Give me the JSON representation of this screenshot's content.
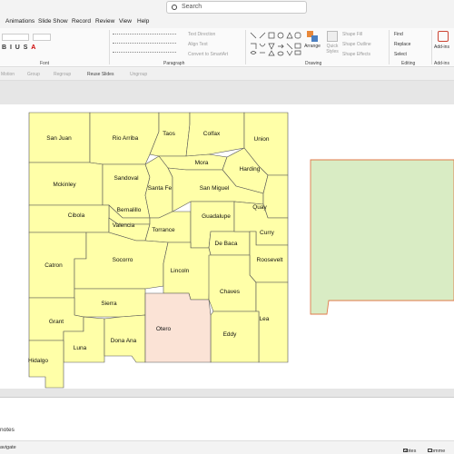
{
  "search": {
    "placeholder": "Search"
  },
  "tabs": [
    "Animations",
    "Slide Show",
    "Record",
    "Review",
    "View",
    "Help"
  ],
  "ribbon": {
    "groups": {
      "font": "Font",
      "paragraph": "Paragraph",
      "drawing": "Drawing",
      "editing": "Editing",
      "addins": "Add-ins"
    },
    "text_direction": "Text Direction",
    "align_text": "Align Text",
    "convert_smartart": "Convert to SmartArt",
    "arrange": "Arrange",
    "quick_styles": "Quick Styles",
    "shape_fill": "Shape Fill",
    "shape_outline": "Shape Outline",
    "shape_effects": "Shape Effects",
    "find": "Find",
    "replace": "Replace",
    "select": "Select",
    "addins_btn": "Add-ins"
  },
  "qat": {
    "motion": "Motion",
    "group": "Group",
    "regroup": "Regroup",
    "reuse": "Reuse Slides",
    "ungroup": "Ungroup"
  },
  "colors": {
    "county": "#ffffa8",
    "otero": "#fbe3d6",
    "green": "#d9ecc4",
    "green_border": "#e07a4a",
    "border": "#555555"
  },
  "map": {
    "counties": [
      "San Juan",
      "Rio Arriba",
      "Taos",
      "Colfax",
      "Union",
      "Mora",
      "Harding",
      "Mckinley",
      "Sandoval",
      "Santa Fe",
      "San Miguel",
      "Quay",
      "Bernalillo",
      "Cibola",
      "Valencia",
      "Torrance",
      "Guadalupe",
      "De Baca",
      "Curry",
      "Roosevelt",
      "Catron",
      "Socorro",
      "Lincoln",
      "Chaves",
      "Sierra",
      "Otero",
      "Lea",
      "Eddy",
      "Grant",
      "Luna",
      "Dona Ana",
      "Hidalgo"
    ]
  },
  "notes": {
    "label": "notes"
  },
  "status": {
    "navigate": "avigate",
    "notes_btn": "Notes",
    "comments_btn": "Comme"
  }
}
